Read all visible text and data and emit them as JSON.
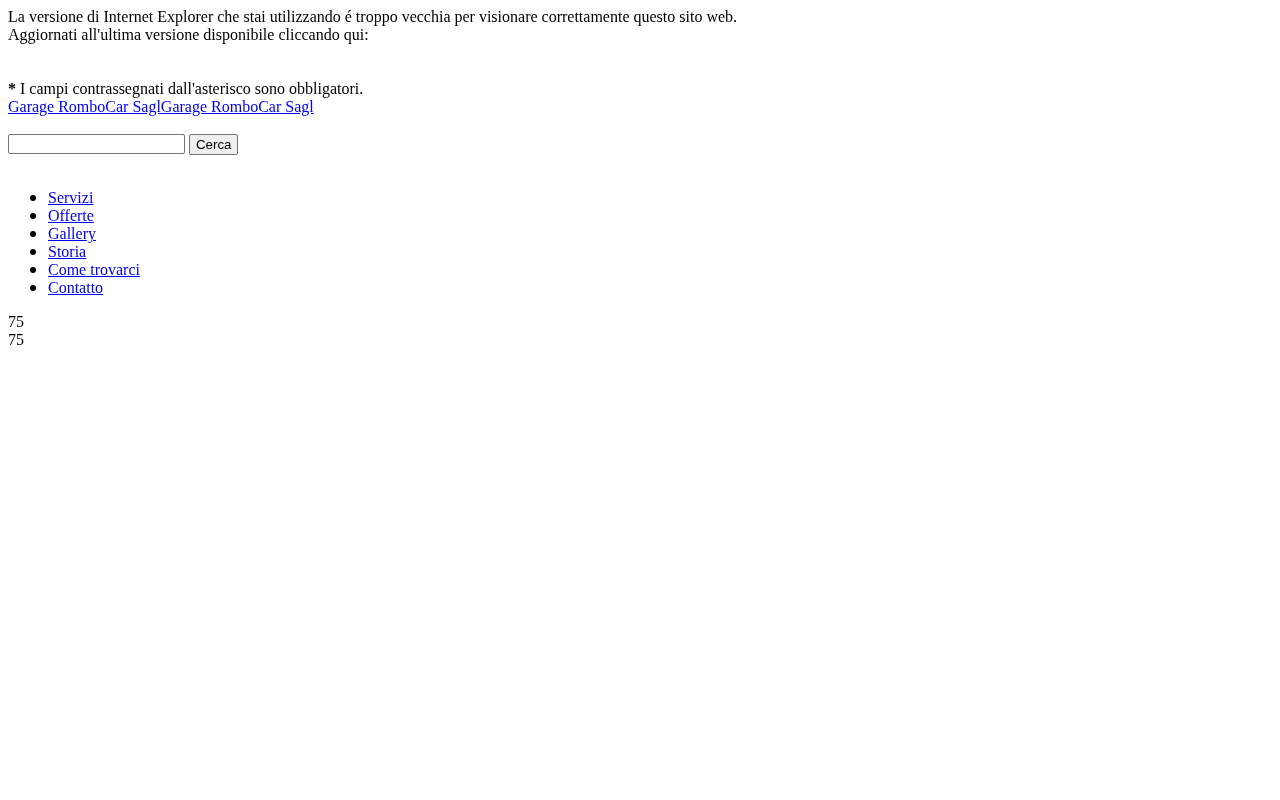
{
  "browser_warning": [
    "La versione di Internet Explorer  che stai utilizzando é troppo vecchia per visionare correttamente questo sito web.",
    "Aggiornati all'ultima versione disponibile cliccando qui:"
  ],
  "required_note": {
    "mark": "*",
    "text": "I campi contrassegnati dall'asterisco sono obbligatori."
  },
  "site_links": [
    "Garage RomboCar Sagl",
    "Garage RomboCar Sagl"
  ],
  "search": {
    "button": "Cerca"
  },
  "nav": [
    "Servizi",
    "Offerte",
    "Gallery",
    "Storia",
    "Come trovarci",
    "Contatto"
  ],
  "counters": [
    "75",
    "75"
  ]
}
